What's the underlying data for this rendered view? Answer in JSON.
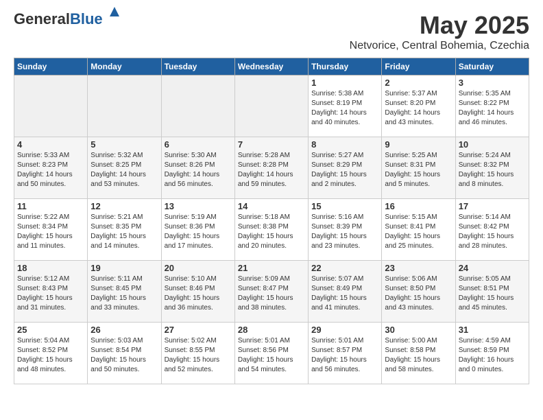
{
  "header": {
    "logo_general": "General",
    "logo_blue": "Blue",
    "month": "May 2025",
    "location": "Netvorice, Central Bohemia, Czechia"
  },
  "days_of_week": [
    "Sunday",
    "Monday",
    "Tuesday",
    "Wednesday",
    "Thursday",
    "Friday",
    "Saturday"
  ],
  "weeks": [
    [
      {
        "day": "",
        "info": ""
      },
      {
        "day": "",
        "info": ""
      },
      {
        "day": "",
        "info": ""
      },
      {
        "day": "",
        "info": ""
      },
      {
        "day": "1",
        "info": "Sunrise: 5:38 AM\nSunset: 8:19 PM\nDaylight: 14 hours\nand 40 minutes."
      },
      {
        "day": "2",
        "info": "Sunrise: 5:37 AM\nSunset: 8:20 PM\nDaylight: 14 hours\nand 43 minutes."
      },
      {
        "day": "3",
        "info": "Sunrise: 5:35 AM\nSunset: 8:22 PM\nDaylight: 14 hours\nand 46 minutes."
      }
    ],
    [
      {
        "day": "4",
        "info": "Sunrise: 5:33 AM\nSunset: 8:23 PM\nDaylight: 14 hours\nand 50 minutes."
      },
      {
        "day": "5",
        "info": "Sunrise: 5:32 AM\nSunset: 8:25 PM\nDaylight: 14 hours\nand 53 minutes."
      },
      {
        "day": "6",
        "info": "Sunrise: 5:30 AM\nSunset: 8:26 PM\nDaylight: 14 hours\nand 56 minutes."
      },
      {
        "day": "7",
        "info": "Sunrise: 5:28 AM\nSunset: 8:28 PM\nDaylight: 14 hours\nand 59 minutes."
      },
      {
        "day": "8",
        "info": "Sunrise: 5:27 AM\nSunset: 8:29 PM\nDaylight: 15 hours\nand 2 minutes."
      },
      {
        "day": "9",
        "info": "Sunrise: 5:25 AM\nSunset: 8:31 PM\nDaylight: 15 hours\nand 5 minutes."
      },
      {
        "day": "10",
        "info": "Sunrise: 5:24 AM\nSunset: 8:32 PM\nDaylight: 15 hours\nand 8 minutes."
      }
    ],
    [
      {
        "day": "11",
        "info": "Sunrise: 5:22 AM\nSunset: 8:34 PM\nDaylight: 15 hours\nand 11 minutes."
      },
      {
        "day": "12",
        "info": "Sunrise: 5:21 AM\nSunset: 8:35 PM\nDaylight: 15 hours\nand 14 minutes."
      },
      {
        "day": "13",
        "info": "Sunrise: 5:19 AM\nSunset: 8:36 PM\nDaylight: 15 hours\nand 17 minutes."
      },
      {
        "day": "14",
        "info": "Sunrise: 5:18 AM\nSunset: 8:38 PM\nDaylight: 15 hours\nand 20 minutes."
      },
      {
        "day": "15",
        "info": "Sunrise: 5:16 AM\nSunset: 8:39 PM\nDaylight: 15 hours\nand 23 minutes."
      },
      {
        "day": "16",
        "info": "Sunrise: 5:15 AM\nSunset: 8:41 PM\nDaylight: 15 hours\nand 25 minutes."
      },
      {
        "day": "17",
        "info": "Sunrise: 5:14 AM\nSunset: 8:42 PM\nDaylight: 15 hours\nand 28 minutes."
      }
    ],
    [
      {
        "day": "18",
        "info": "Sunrise: 5:12 AM\nSunset: 8:43 PM\nDaylight: 15 hours\nand 31 minutes."
      },
      {
        "day": "19",
        "info": "Sunrise: 5:11 AM\nSunset: 8:45 PM\nDaylight: 15 hours\nand 33 minutes."
      },
      {
        "day": "20",
        "info": "Sunrise: 5:10 AM\nSunset: 8:46 PM\nDaylight: 15 hours\nand 36 minutes."
      },
      {
        "day": "21",
        "info": "Sunrise: 5:09 AM\nSunset: 8:47 PM\nDaylight: 15 hours\nand 38 minutes."
      },
      {
        "day": "22",
        "info": "Sunrise: 5:07 AM\nSunset: 8:49 PM\nDaylight: 15 hours\nand 41 minutes."
      },
      {
        "day": "23",
        "info": "Sunrise: 5:06 AM\nSunset: 8:50 PM\nDaylight: 15 hours\nand 43 minutes."
      },
      {
        "day": "24",
        "info": "Sunrise: 5:05 AM\nSunset: 8:51 PM\nDaylight: 15 hours\nand 45 minutes."
      }
    ],
    [
      {
        "day": "25",
        "info": "Sunrise: 5:04 AM\nSunset: 8:52 PM\nDaylight: 15 hours\nand 48 minutes."
      },
      {
        "day": "26",
        "info": "Sunrise: 5:03 AM\nSunset: 8:54 PM\nDaylight: 15 hours\nand 50 minutes."
      },
      {
        "day": "27",
        "info": "Sunrise: 5:02 AM\nSunset: 8:55 PM\nDaylight: 15 hours\nand 52 minutes."
      },
      {
        "day": "28",
        "info": "Sunrise: 5:01 AM\nSunset: 8:56 PM\nDaylight: 15 hours\nand 54 minutes."
      },
      {
        "day": "29",
        "info": "Sunrise: 5:01 AM\nSunset: 8:57 PM\nDaylight: 15 hours\nand 56 minutes."
      },
      {
        "day": "30",
        "info": "Sunrise: 5:00 AM\nSunset: 8:58 PM\nDaylight: 15 hours\nand 58 minutes."
      },
      {
        "day": "31",
        "info": "Sunrise: 4:59 AM\nSunset: 8:59 PM\nDaylight: 16 hours\nand 0 minutes."
      }
    ]
  ]
}
